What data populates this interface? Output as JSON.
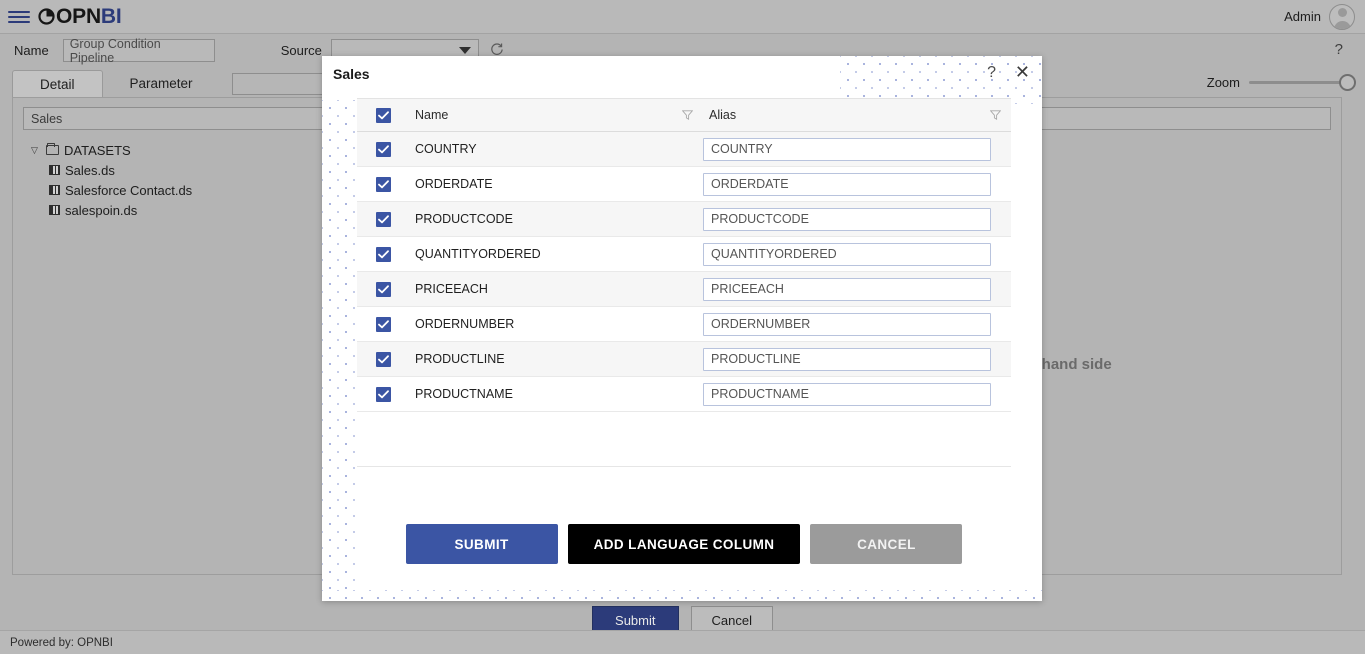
{
  "app": {
    "brand_prefix": "OPN",
    "brand_suffix": "BI",
    "user_label": "Admin",
    "footer_note": "Powered by: OPNBI"
  },
  "toolbar": {
    "name_label": "Name",
    "name_value": "Group Condition Pipeline",
    "source_label": "Source",
    "source_value": "",
    "refresh_icon": "refresh-icon",
    "help_icon": "?"
  },
  "zoom": {
    "label": "Zoom",
    "value": 100
  },
  "tabs": [
    {
      "label": "Detail",
      "active": true
    },
    {
      "label": "Parameter",
      "active": false
    }
  ],
  "panel": {
    "search_value": "Sales",
    "tree": [
      {
        "label": "DATASETS",
        "type": "folder",
        "expanded": true
      },
      {
        "label": "Sales.ds",
        "type": "dataset"
      },
      {
        "label": "Salesforce Contact.ds",
        "type": "dataset"
      },
      {
        "label": "salespoin.ds",
        "type": "dataset"
      }
    ],
    "hint_text": "left hand side"
  },
  "page_actions": {
    "submit_label": "Submit",
    "cancel_label": "Cancel"
  },
  "modal": {
    "title": "Sales",
    "help_icon": "?",
    "close_icon": "✕",
    "columns": {
      "select_all_checked": true,
      "name_header": "Name",
      "alias_header": "Alias"
    },
    "rows": [
      {
        "checked": true,
        "name": "COUNTRY",
        "alias": "COUNTRY"
      },
      {
        "checked": true,
        "name": "ORDERDATE",
        "alias": "ORDERDATE"
      },
      {
        "checked": true,
        "name": "PRODUCTCODE",
        "alias": "PRODUCTCODE"
      },
      {
        "checked": true,
        "name": "QUANTITYORDERED",
        "alias": "QUANTITYORDERED"
      },
      {
        "checked": true,
        "name": "PRICEEACH",
        "alias": "PRICEEACH"
      },
      {
        "checked": true,
        "name": "ORDERNUMBER",
        "alias": "ORDERNUMBER"
      },
      {
        "checked": true,
        "name": "PRODUCTLINE",
        "alias": "PRODUCTLINE"
      },
      {
        "checked": true,
        "name": "PRODUCTNAME",
        "alias": "PRODUCTNAME"
      }
    ],
    "buttons": {
      "submit": "SUBMIT",
      "add_language_column": "ADD LANGUAGE COLUMN",
      "cancel": "CANCEL"
    }
  },
  "colors": {
    "accent_blue": "#3b55a4",
    "brand_navy": "#2c3b7a",
    "black_button": "#000000",
    "muted_button": "#9b9b9b",
    "app_background": "#b4b4b4"
  }
}
